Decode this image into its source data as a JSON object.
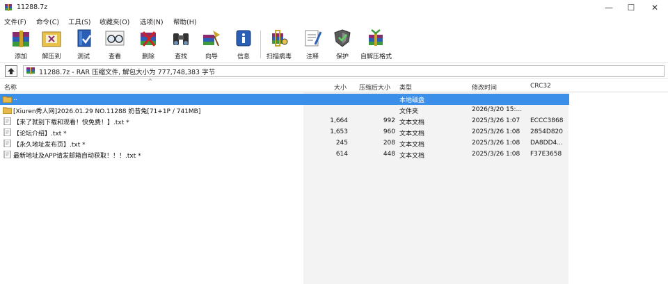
{
  "window": {
    "title": "11288.7z",
    "minimize": "—",
    "maximize": "☐",
    "close": "✕"
  },
  "menu": [
    "文件(F)",
    "命令(C)",
    "工具(S)",
    "收藏夹(O)",
    "选项(N)",
    "帮助(H)"
  ],
  "toolbar": [
    "添加",
    "解压到",
    "测试",
    "查看",
    "删除",
    "查找",
    "向导",
    "信息",
    "扫描病毒",
    "注释",
    "保护",
    "自解压格式"
  ],
  "path": {
    "text": "11288.7z - RAR 压缩文件, 解包大小为 777,748,383 字节"
  },
  "columns": {
    "name": "名称",
    "size": "大小",
    "packed": "压缩后大小",
    "type": "类型",
    "modified": "修改时间",
    "crc": "CRC32"
  },
  "rows": [
    {
      "name": "..",
      "size": "",
      "packed": "",
      "type": "本地磁盘",
      "modified": "",
      "crc": "",
      "icon": "folder-icon"
    },
    {
      "name": "[Xiuren秀人网]2026.01.29 NO.11288 奶昔兔[71+1P / 741MB]",
      "size": "",
      "packed": "",
      "type": "文件夹",
      "modified": "2026/3/20 15:...",
      "crc": "",
      "icon": "folder-icon"
    },
    {
      "name": "【来了就别下载和观看！快免费！】.txt *",
      "size": "1,664",
      "packed": "992",
      "type": "文本文档",
      "modified": "2025/3/26 1:07",
      "crc": "ECCC3868",
      "icon": "text-file-icon"
    },
    {
      "name": "【论坛介绍】.txt *",
      "size": "1,653",
      "packed": "960",
      "type": "文本文档",
      "modified": "2025/3/26 1:08",
      "crc": "2854D820",
      "icon": "text-file-icon"
    },
    {
      "name": "【永久地址发布页】.txt *",
      "size": "245",
      "packed": "208",
      "type": "文本文档",
      "modified": "2025/3/26 1:08",
      "crc": "DA8DD4...",
      "icon": "text-file-icon"
    },
    {
      "name": "最新地址及APP请发邮箱自动获取！！！.txt *",
      "size": "614",
      "packed": "448",
      "type": "文本文档",
      "modified": "2025/3/26 1:08",
      "crc": "F37E3658",
      "icon": "text-file-icon"
    }
  ]
}
